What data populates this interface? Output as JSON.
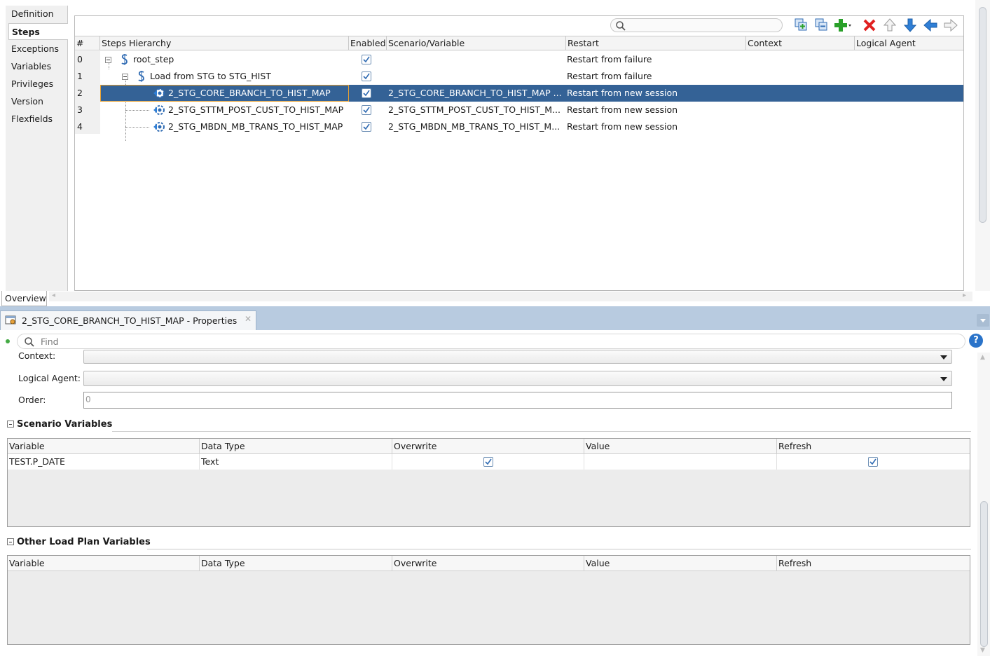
{
  "side_tabs": [
    "Definition",
    "Steps",
    "Exceptions",
    "Variables",
    "Privileges",
    "Version",
    "Flexfields"
  ],
  "active_tab": "Steps",
  "steps_grid": {
    "columns": [
      "#",
      "Steps Hierarchy",
      "Enabled",
      "Scenario/Variable",
      "Restart",
      "Context",
      "Logical Agent"
    ],
    "rows": [
      {
        "num": "0",
        "name": "root_step",
        "enabled": true,
        "scenario": "",
        "restart": "Restart from failure"
      },
      {
        "num": "1",
        "name": "Load from STG to STG_HIST",
        "enabled": true,
        "scenario": "",
        "restart": "Restart from failure"
      },
      {
        "num": "2",
        "name": "2_STG_CORE_BRANCH_TO_HIST_MAP",
        "enabled": true,
        "scenario": "2_STG_CORE_BRANCH_TO_HIST_MAP ...",
        "restart": "Restart from new session"
      },
      {
        "num": "3",
        "name": "2_STG_STTM_POST_CUST_TO_HIST_MAP",
        "enabled": true,
        "scenario": "2_STG_STTM_POST_CUST_TO_HIST_M...",
        "restart": "Restart from new session"
      },
      {
        "num": "4",
        "name": "2_STG_MBDN_MB_TRANS_TO_HIST_MAP",
        "enabled": true,
        "scenario": "2_STG_MBDN_MB_TRANS_TO_HIST_M...",
        "restart": "Restart from new session"
      }
    ],
    "selected_row": 2
  },
  "toolbar_icons": [
    "add-step-icon",
    "remove-step-icon",
    "add-icon",
    "delete-icon",
    "move-up-icon",
    "move-down-icon",
    "move-left-icon",
    "move-right-icon"
  ],
  "bottom_tab": "Overview",
  "properties": {
    "tab_title": "2_STG_CORE_BRANCH_TO_HIST_MAP - Properties",
    "find_placeholder": "Find",
    "help": "?",
    "fields": {
      "context_label": "Context:",
      "logical_agent_label": "Logical Agent:",
      "order_label": "Order:",
      "order_value": "0"
    },
    "scenario_variables": {
      "title": "Scenario Variables",
      "columns": [
        "Variable",
        "Data Type",
        "Overwrite",
        "Value",
        "Refresh"
      ],
      "rows": [
        {
          "variable": "TEST.P_DATE",
          "data_type": "Text",
          "overwrite": true,
          "value": "",
          "refresh": true
        }
      ]
    },
    "other_variables": {
      "title": "Other Load Plan Variables",
      "columns": [
        "Variable",
        "Data Type",
        "Overwrite",
        "Value",
        "Refresh"
      ]
    }
  },
  "colors": {
    "selection": "#346296",
    "tabbar": "#b8cbe0",
    "checkbox_border": "#6d8fb5",
    "delete_red": "#e02020",
    "add_green": "#2aa02a",
    "arrow_blue": "#2f7fd6"
  }
}
